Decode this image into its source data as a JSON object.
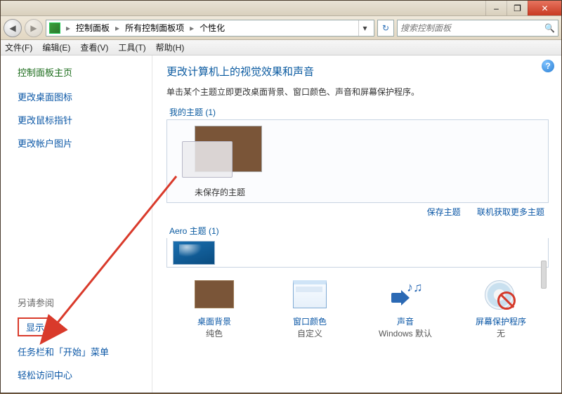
{
  "titlebar": {
    "min": "–",
    "max": "❐",
    "close": "✕"
  },
  "nav": {
    "crumb1": "控制面板",
    "crumb2": "所有控制面板项",
    "crumb3": "个性化",
    "search_placeholder": "搜索控制面板"
  },
  "menu": {
    "file": "文件(F)",
    "edit": "编辑(E)",
    "view": "查看(V)",
    "tools": "工具(T)",
    "help": "帮助(H)"
  },
  "sidebar": {
    "home": "控制面板主页",
    "links": [
      "更改桌面图标",
      "更改鼠标指针",
      "更改帐户图片"
    ],
    "seealso": "另请参阅",
    "display": "显示",
    "taskbar": "任务栏和「开始」菜单",
    "ease": "轻松访问中心"
  },
  "content": {
    "heading": "更改计算机上的视觉效果和声音",
    "desc": "单击某个主题立即更改桌面背景、窗口颜色、声音和屏幕保护程序。",
    "my_themes_label": "我的主题 (1)",
    "unsaved_theme": "未保存的主题",
    "save_theme": "保存主题",
    "get_more": "联机获取更多主题",
    "aero_label": "Aero 主题 (1)",
    "bottom": [
      {
        "t1": "桌面背景",
        "t2": "纯色"
      },
      {
        "t1": "窗口颜色",
        "t2": "自定义"
      },
      {
        "t1": "声音",
        "t2": "Windows 默认"
      },
      {
        "t1": "屏幕保护程序",
        "t2": "无"
      }
    ]
  }
}
